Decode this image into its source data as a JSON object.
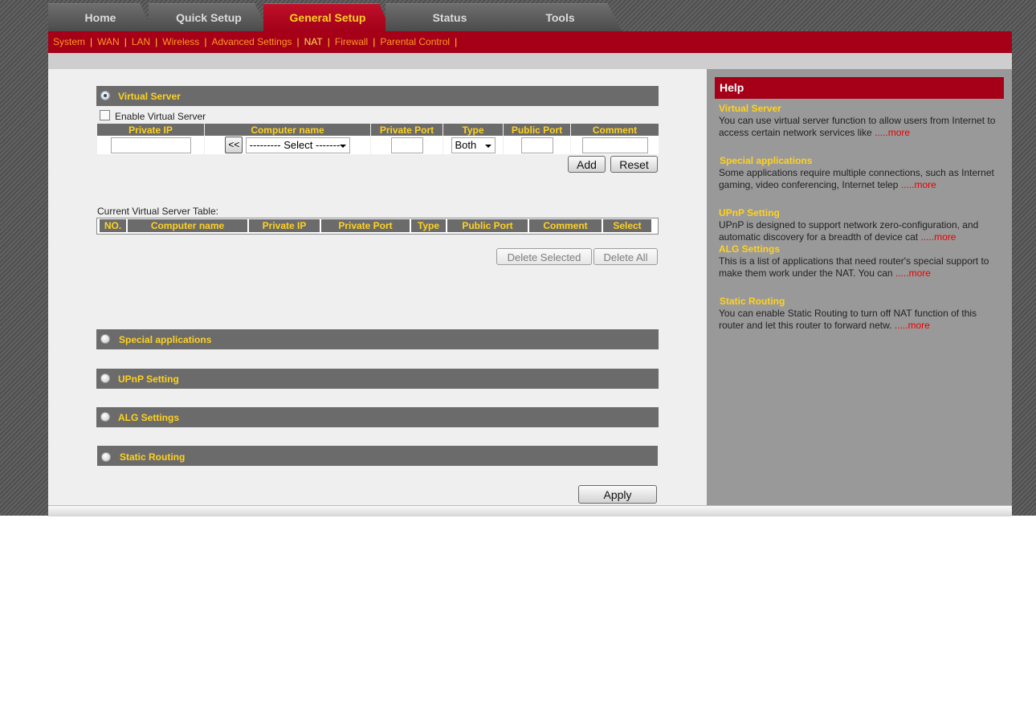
{
  "tabs": [
    {
      "label": "Home"
    },
    {
      "label": "Quick Setup"
    },
    {
      "label": "General Setup"
    },
    {
      "label": "Status"
    },
    {
      "label": "Tools"
    }
  ],
  "subnav": [
    "System",
    "WAN",
    "LAN",
    "Wireless",
    "Advanced Settings",
    "NAT",
    "Firewall",
    "Parental Control"
  ],
  "subnav_sep": "|",
  "virtual_server": {
    "title": "Virtual Server",
    "enable_label": "Enable Virtual Server",
    "columns": [
      "Private IP",
      "Computer name",
      "Private Port",
      "Type",
      "Public Port",
      "Comment"
    ],
    "copy_button": "<<",
    "computer_select": "--------- Select -------",
    "type_value": "Both",
    "add": "Add",
    "reset": "Reset",
    "table_caption": "Current Virtual Server Table:",
    "table_columns": [
      "NO.",
      "Computer name",
      "Private IP",
      "Private Port",
      "Type",
      "Public Port",
      "Comment",
      "Select"
    ],
    "delete_selected": "Delete Selected",
    "delete_all": "Delete All"
  },
  "sections": [
    "Special applications",
    "UPnP Setting",
    "ALG Settings",
    "Static Routing"
  ],
  "apply": "Apply",
  "help": {
    "title": "Help",
    "more_label": ".....more",
    "items": [
      {
        "title": "Virtual Server",
        "text": "You can use virtual server function to allow users from Internet to access certain network services like "
      },
      {
        "title": "Special applications",
        "text": "Some applications require multiple connections, such as Internet gaming, video conferencing, Internet telep "
      },
      {
        "title": "UPnP Setting",
        "text": "UPnP is designed to support network zero-configuration, and automatic discovery for a breadth of device cat "
      },
      {
        "title": "ALG Settings",
        "text": "This is a list of applications that need router's special support to make them work under the NAT. You can "
      },
      {
        "title": "Static Routing",
        "text": "You can enable Static Routing to turn off NAT function of this router and let this router to forward netw. "
      }
    ]
  },
  "colors": {
    "brand_red": "#a50018",
    "accent_yellow": "#ffd21f",
    "link_orange": "#ff9a1e",
    "more_red": "#e80000"
  }
}
